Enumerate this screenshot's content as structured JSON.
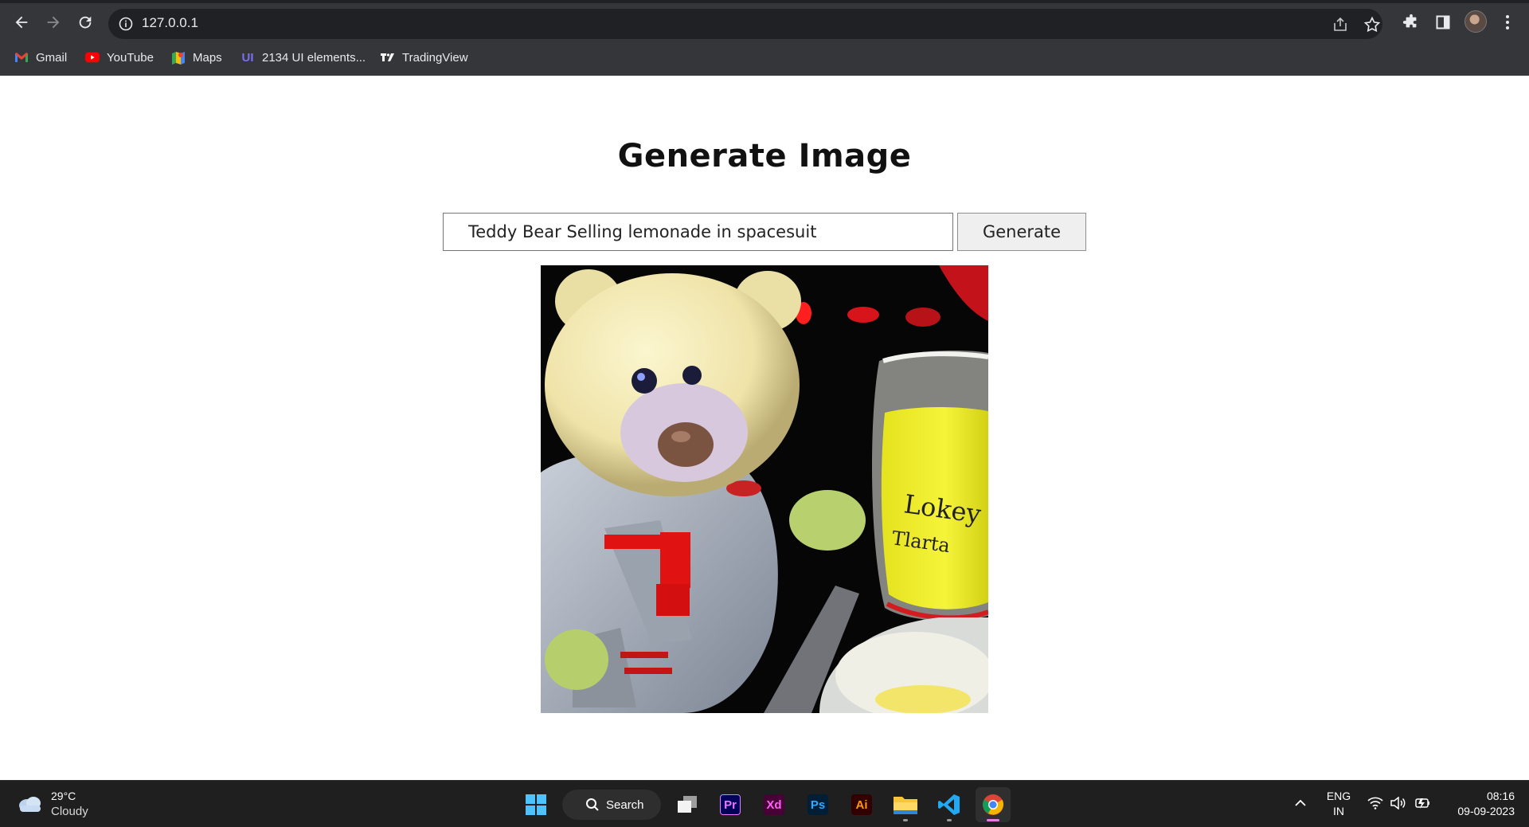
{
  "browser": {
    "url": "127.0.0.1",
    "bookmarks": [
      {
        "label": "Gmail",
        "icon": "gmail-icon"
      },
      {
        "label": "YouTube",
        "icon": "youtube-icon"
      },
      {
        "label": "Maps",
        "icon": "maps-icon"
      },
      {
        "label": "2134 UI elements...",
        "icon": "ui-elements-icon"
      },
      {
        "label": "TradingView",
        "icon": "tradingview-icon"
      }
    ]
  },
  "page": {
    "title": "Generate Image",
    "prompt_value": "Teddy Bear Selling lemonade in spacesuit",
    "generate_label": "Generate",
    "image_description_icon": "generated-image"
  },
  "taskbar": {
    "weather": {
      "temp": "29°C",
      "condition": "Cloudy"
    },
    "search_label": "Search",
    "apps": [
      "windows-start-icon",
      "task-view-icon",
      "premiere-pro-icon",
      "xd-icon",
      "photoshop-icon",
      "illustrator-icon",
      "file-explorer-icon",
      "vscode-icon",
      "chrome-icon"
    ],
    "adobe": {
      "pr": "Pr",
      "xd": "Xd",
      "ps": "Ps",
      "ai": "Ai"
    },
    "language": {
      "line1": "ENG",
      "line2": "IN"
    },
    "clock": {
      "time": "08:16",
      "date": "09-09-2023"
    }
  },
  "colors": {
    "chrome_bg": "#35363a",
    "omnibox_bg": "#202124",
    "taskbar_bg": "#1f1f1f",
    "button_bg": "#efefef"
  }
}
